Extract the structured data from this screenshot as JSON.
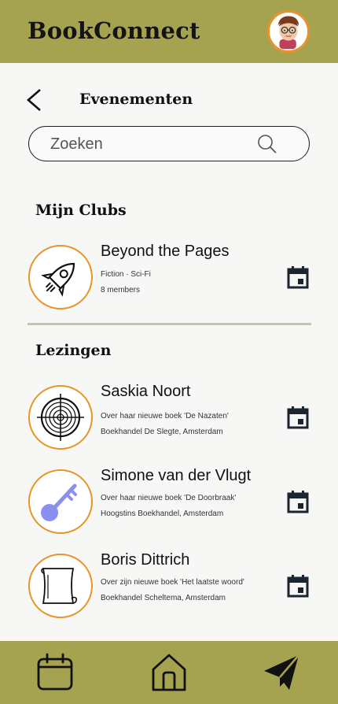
{
  "app": {
    "title": "BookConnect"
  },
  "header": {
    "title": "Evenementen",
    "back_icon": "chevron-left-icon"
  },
  "search": {
    "placeholder": "Zoeken",
    "value": "",
    "icon": "search-icon"
  },
  "sections": {
    "my_clubs": {
      "title": "Mijn Clubs",
      "items": [
        {
          "name": "Beyond the Pages",
          "line1": "Fiction · Sci-Fi",
          "line2": "8 members",
          "icon": "rocket-icon"
        }
      ]
    },
    "lectures": {
      "title": "Lezingen",
      "items": [
        {
          "name": "Saskia Noort",
          "line1": "Over haar nieuwe boek 'De Nazaten'",
          "line2": "Boekhandel De Slegte, Amsterdam",
          "icon": "crosshair-target-icon"
        },
        {
          "name": "Simone van der Vlugt",
          "line1": "Over haar nieuwe boek 'De Doorbraak'",
          "line2": "Hoogstins Boekhandel, Amsterdam",
          "icon": "key-icon"
        },
        {
          "name": "Boris Dittrich",
          "line1": "Over zijn nieuwe boek 'Het laatste woord'",
          "line2": "Boekhandel Scheltema, Amsterdam",
          "icon": "scroll-icon"
        }
      ]
    }
  },
  "bottom_nav": {
    "items": [
      "calendar-icon",
      "home-icon",
      "send-icon"
    ]
  },
  "colors": {
    "bar": "#a6a350",
    "accent": "#e8942a",
    "key": "#8a8ff0",
    "background": "#f7f7f6"
  }
}
